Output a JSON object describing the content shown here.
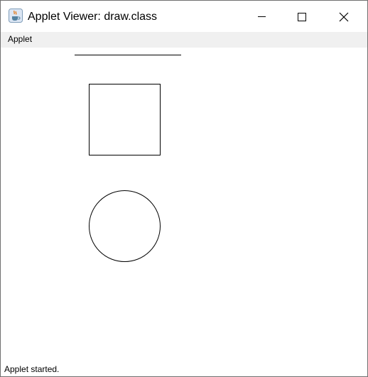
{
  "window": {
    "title": "Applet Viewer: draw.class",
    "app_icon": "java-coffee-cup-icon",
    "controls": {
      "minimize_icon": "minimize-icon",
      "maximize_icon": "maximize-icon",
      "close_icon": "close-icon"
    }
  },
  "menubar": {
    "items": [
      {
        "label": "Applet"
      }
    ]
  },
  "canvas": {
    "shapes": [
      "line",
      "rectangle",
      "circle"
    ],
    "stroke_color": "#000000"
  },
  "statusbar": {
    "text": "Applet started."
  }
}
